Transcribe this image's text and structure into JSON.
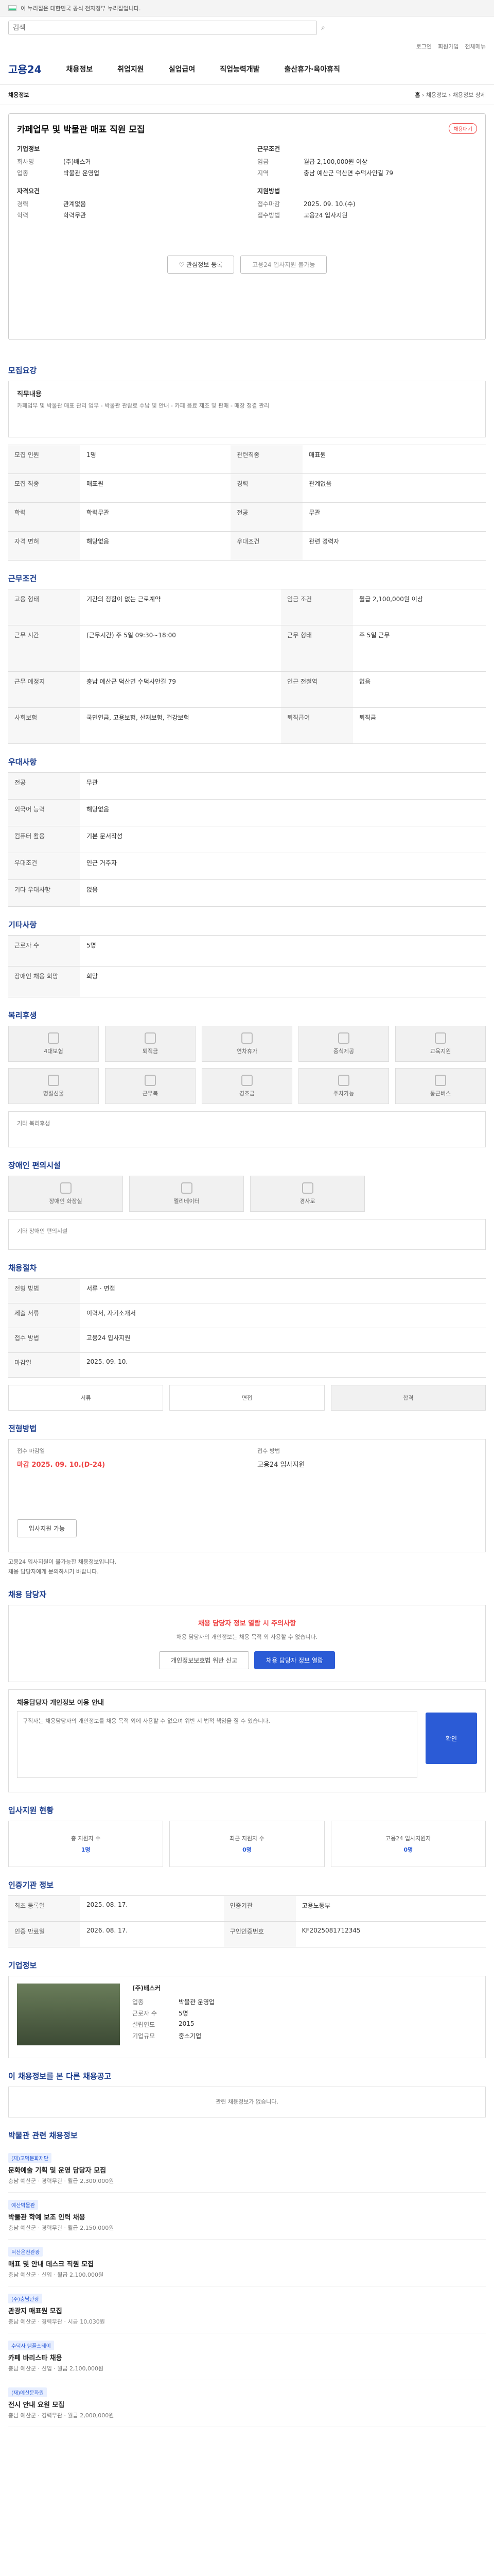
{
  "gov": {
    "label": "이 누리집은 대한민국 공식 전자정부 누리집입니다."
  },
  "search": {
    "placeholder": "검색"
  },
  "user_links": [
    "로그인",
    "회원가입",
    "전체메뉴"
  ],
  "nav": {
    "logo": "고용24",
    "items": [
      "채용정보",
      "취업지원",
      "실업급여",
      "직업능력개발",
      "출산휴가·육아휴직"
    ]
  },
  "sub": {
    "label": "채용정보",
    "crumbs": [
      "홈",
      "채용정보",
      "채용정보 상세"
    ]
  },
  "job": {
    "title": "카페업무 및 박물관 매표 직원 모집",
    "tag": "채용대기",
    "company_label": "기업정보",
    "company_rows": [
      [
        "회사명",
        "(주)배스커"
      ],
      [
        "업종",
        "박물관 운영업"
      ]
    ],
    "cond_label": "근무조건",
    "cond_rows": [
      [
        "임금",
        "월급 2,100,000원 이상"
      ],
      [
        "지역",
        "충남 예산군 덕산면 수덕사안길 79"
      ]
    ],
    "apply_label": "지원방법",
    "apply_rows": [
      [
        "접수마감",
        "2025. 09. 10.(수)"
      ],
      [
        "접수방법",
        "고용24 입사지원"
      ]
    ],
    "qual_label": "자격요건",
    "qual_rows": [
      [
        "경력",
        "관계없음"
      ],
      [
        "학력",
        "학력무관"
      ]
    ],
    "fav_btn": "관심정보 등록",
    "apply_btn": "고용24 입사지원 불가능"
  },
  "t1": {
    "title": "모집요강",
    "desc_label": "직무내용",
    "desc": "카페업무 및 박물관 매표 관리 업무 - 박물관 관람료 수납 및 안내 - 카페 음료 제조 및 판매 - 매장 청결 관리",
    "rows": [
      [
        "모집 인원",
        "1명",
        "관련직종",
        "매표원"
      ],
      [
        "모집 직종",
        "매표원",
        "경력",
        "관계없음"
      ],
      [
        "학력",
        "학력무관",
        "전공",
        "무관"
      ],
      [
        "자격 면허",
        "해당없음",
        "우대조건",
        "관련 경력자"
      ]
    ]
  },
  "t2": {
    "title": "근무조건",
    "rows": [
      [
        "고용 형태",
        "기간의 정함이 없는 근로계약",
        "임금 조건",
        "월급 2,100,000원 이상"
      ],
      [
        "근무 시간",
        "(근무시간) 주 5일 09:30~18:00",
        "근무 형태",
        "주 5일 근무"
      ],
      [
        "근무 예정지",
        "충남 예산군 덕산면 수덕사안길 79",
        "인근 전철역",
        "없음"
      ],
      [
        "사회보험",
        "국민연금, 고용보험, 산재보험, 건강보험",
        "퇴직급여",
        "퇴직금"
      ]
    ]
  },
  "t3": {
    "title": "우대사항",
    "rows": [
      [
        "전공",
        "무관"
      ],
      [
        "외국어 능력",
        "해당없음"
      ],
      [
        "컴퓨터 활용",
        "기본 문서작성"
      ],
      [
        "우대조건",
        "인근 거주자"
      ],
      [
        "기타 우대사항",
        "없음"
      ]
    ]
  },
  "t4": {
    "title": "기타사항",
    "rows": [
      [
        "근로자 수",
        "5명"
      ],
      [
        "장애인 채용 희망",
        "희망"
      ]
    ]
  },
  "welfare": {
    "title": "복리후생",
    "tiles": [
      "4대보험",
      "퇴직금",
      "연차휴가",
      "중식제공",
      "교육지원",
      "명절선물",
      "근무복",
      "경조금",
      "주차가능",
      "통근버스"
    ],
    "note": "기타 복리후생"
  },
  "disab": {
    "title": "장애인 편의시설",
    "tiles": [
      "장애인 화장실",
      "엘리베이터",
      "경사로"
    ],
    "note": "기타 장애인 편의시설"
  },
  "proc": {
    "title": "채용절차",
    "rows": [
      [
        "전형 방법",
        "서류 · 면접"
      ],
      [
        "제출 서류",
        "이력서, 자기소개서"
      ],
      [
        "접수 방법",
        "고용24 입사지원"
      ],
      [
        "마감일",
        "2025. 09. 10."
      ]
    ],
    "steps": [
      "서류",
      "면접",
      "합격"
    ]
  },
  "apply": {
    "title": "전형방법",
    "deadline_label": "접수 마감일",
    "deadline": "마감 2025. 09. 10.(D-24)",
    "method_label": "접수 방법",
    "method": "고용24 입사지원",
    "btn": "입사지원 가능",
    "notes": [
      "고용24 입사지원이 불가능한 채용정보입니다.",
      "채용 담당자에게 문의하시기 바랍니다."
    ]
  },
  "contact": {
    "title": "채용 담당자",
    "alert": "채용 담당자 정보 열람 시 주의사항",
    "alert_desc": "채용 담당자의 개인정보는 채용 목적 외 사용할 수 없습니다.",
    "btn1": "개인정보보호법 위반 신고",
    "btn2": "채용 담당자 정보 열람",
    "consent_label": "채용담당자 개인정보 이용 안내",
    "consent": "구직자는 채용담당자의 개인정보를 채용 목적 외에 사용할 수 없으며 위반 시 법적 책임을 질 수 있습니다.",
    "submit": "확인"
  },
  "status": {
    "title": "입사지원 현황",
    "items": [
      [
        "총 지원자 수",
        "1명"
      ],
      [
        "최근 지원자 수",
        "0명"
      ],
      [
        "고용24 입사지원자",
        "0명"
      ]
    ]
  },
  "info": {
    "title": "인증기관 정보",
    "rows": [
      [
        "최초 등록일",
        "2025. 08. 17.",
        "인증기관",
        "고용노동부"
      ],
      [
        "인증 만료일",
        "2026. 08. 17.",
        "구인인증번호",
        "KF2025081712345"
      ]
    ]
  },
  "corp": {
    "title": "기업정보",
    "name": "(주)배스커",
    "rows": [
      [
        "기업명",
        "(주)배스커"
      ],
      [
        "업종",
        "박물관 운영업"
      ],
      [
        "근로자 수",
        "5명"
      ],
      [
        "설립연도",
        "2015"
      ],
      [
        "기업규모",
        "중소기업"
      ]
    ]
  },
  "related": {
    "title": "이 채용정보를 본 다른 채용공고",
    "empty": "관련 채용정보가 없습니다."
  },
  "others": {
    "title": "박물관 관련 채용정보",
    "items": [
      {
        "org": "(재)고덕문화재단",
        "title": "문화예술 기획 및 운영 담당자 모집",
        "meta": "충남 예산군 · 경력무관 · 월급 2,300,000원"
      },
      {
        "org": "예산박물관",
        "title": "박물관 학예 보조 인력 채용",
        "meta": "충남 예산군 · 경력무관 · 월급 2,150,000원"
      },
      {
        "org": "덕산온천관광",
        "title": "매표 및 안내 데스크 직원 모집",
        "meta": "충남 예산군 · 신입 · 월급 2,100,000원"
      },
      {
        "org": "(주)충남관광",
        "title": "관광지 매표원 모집",
        "meta": "충남 예산군 · 경력무관 · 시급 10,030원"
      },
      {
        "org": "수덕사 템플스테이",
        "title": "카페 바리스타 채용",
        "meta": "충남 예산군 · 신입 · 월급 2,100,000원"
      },
      {
        "org": "(재)예산문화원",
        "title": "전시 안내 요원 모집",
        "meta": "충남 예산군 · 경력무관 · 월급 2,000,000원"
      }
    ]
  }
}
